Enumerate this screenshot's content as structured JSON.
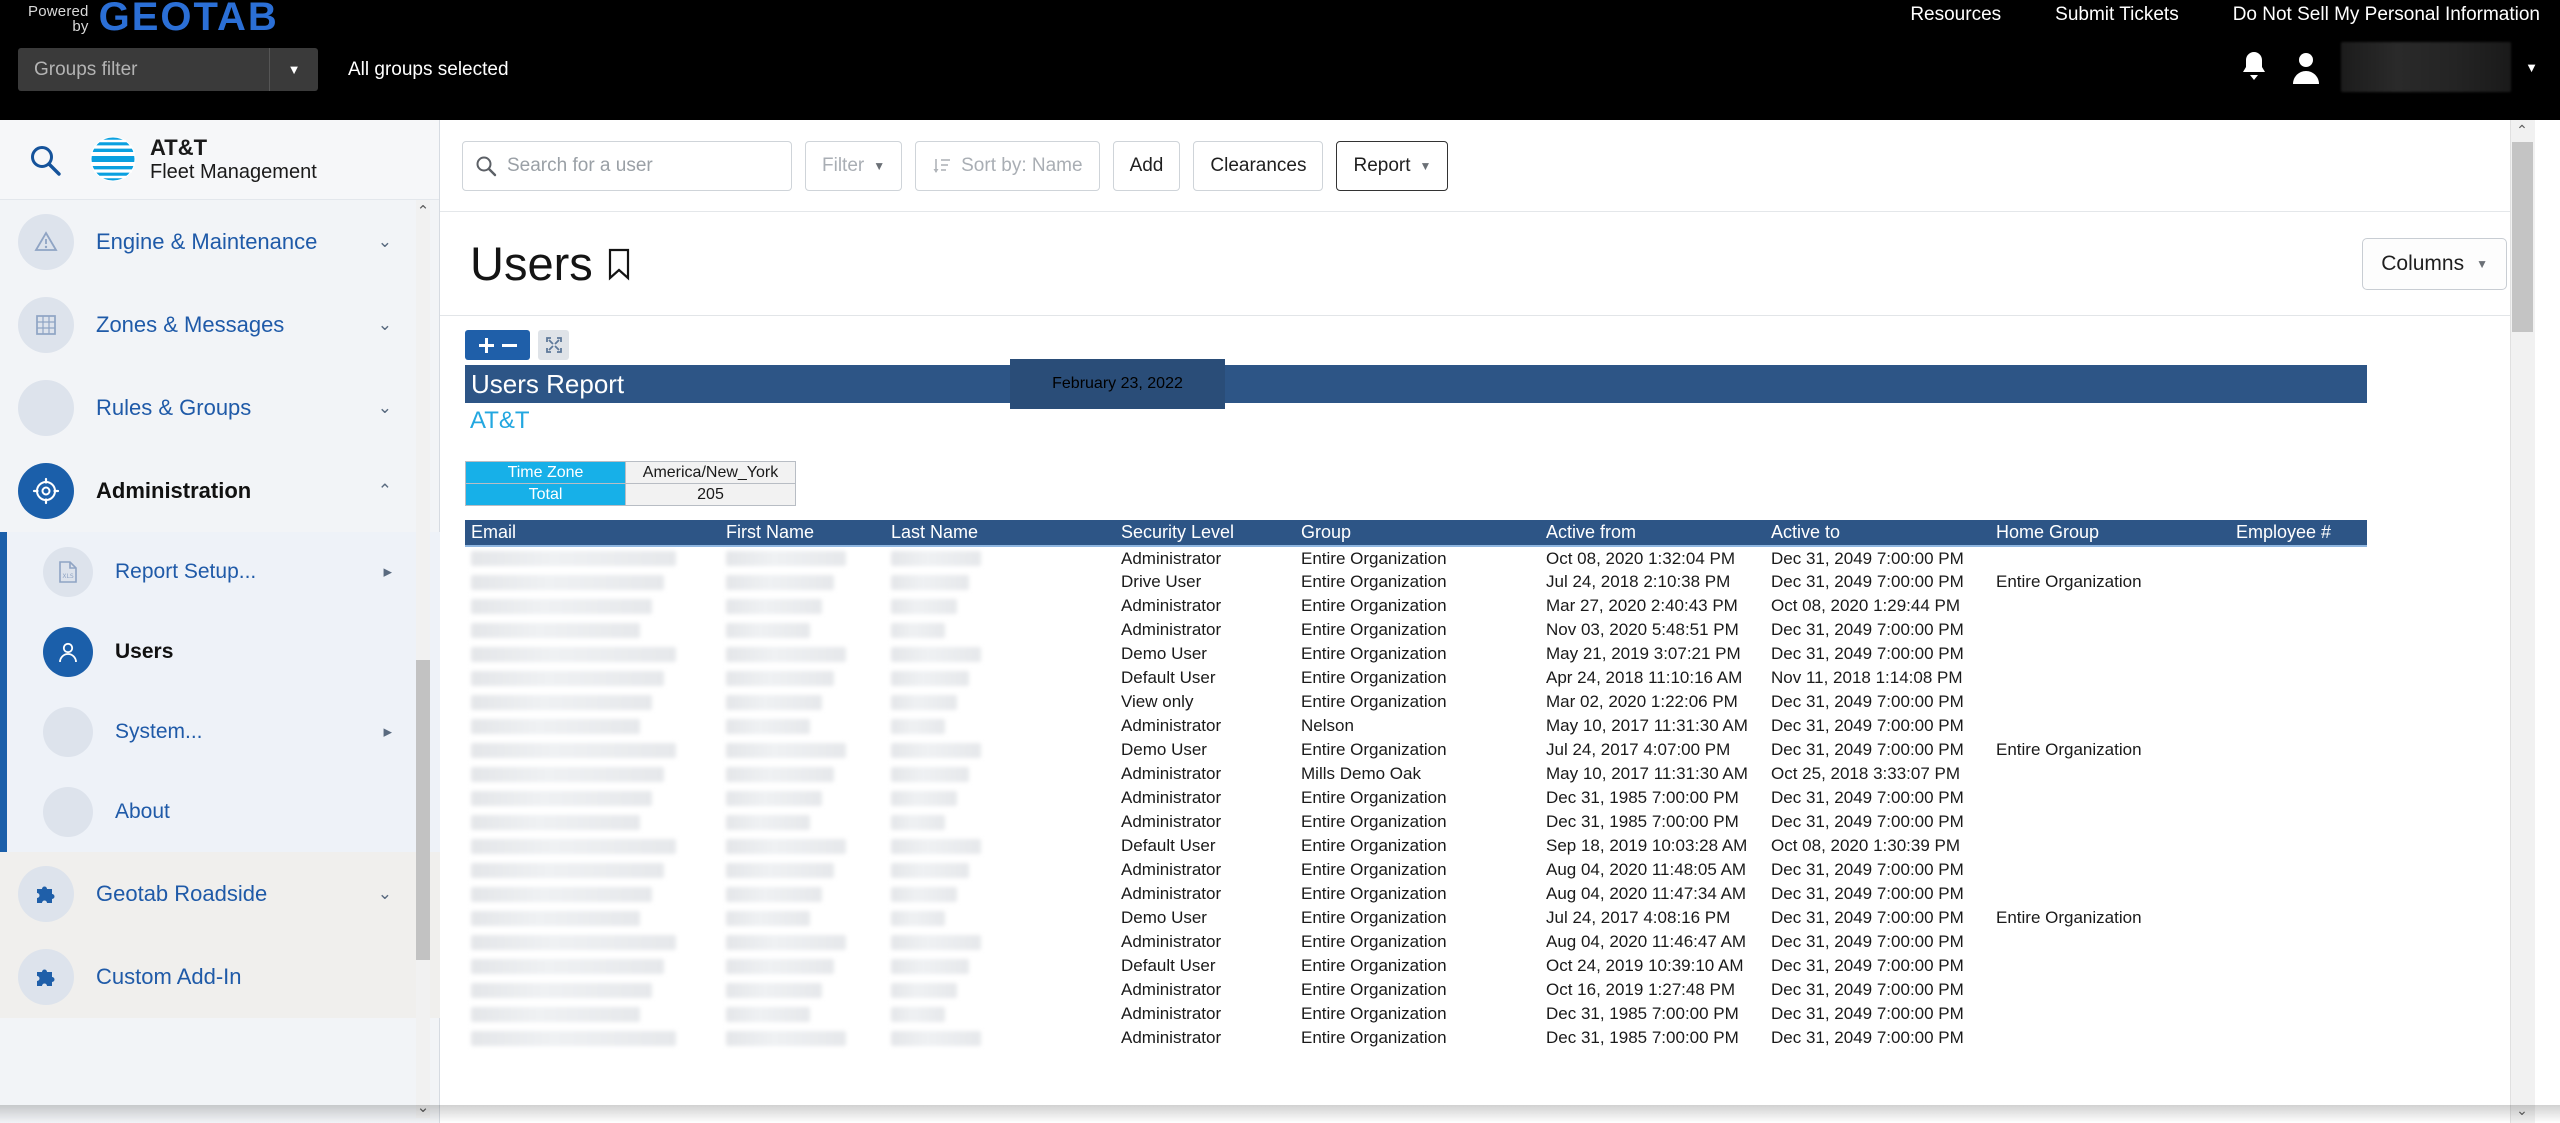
{
  "topbar": {
    "powered_line1": "Powered",
    "powered_line2": "by",
    "logo_text": "GEOTAB",
    "links": [
      {
        "label": "Resources"
      },
      {
        "label": "Submit Tickets"
      },
      {
        "label": "Do Not Sell My Personal Information"
      }
    ],
    "groups_filter_placeholder": "Groups filter",
    "groups_selected_text": "All groups selected",
    "bell_icon": "bell-icon",
    "user_icon": "user-avatar-icon",
    "user_name_redacted": ""
  },
  "sidebar": {
    "search_icon": "search-icon",
    "brand_line1": "AT&T",
    "brand_line2": "Fleet Management",
    "items": [
      {
        "label": "Engine & Maintenance",
        "icon": "engine-warning-icon",
        "expand": "chevron-down-icon",
        "active": false
      },
      {
        "label": "Zones & Messages",
        "icon": "zones-icon",
        "expand": "chevron-down-icon",
        "active": false
      },
      {
        "label": "Rules & Groups",
        "icon": "rules-icon",
        "expand": "chevron-down-icon",
        "active": false
      },
      {
        "label": "Administration",
        "icon": "gear-icon",
        "expand": "chevron-up-icon",
        "active": true
      }
    ],
    "sub_items": [
      {
        "label": "Report Setup...",
        "icon": "xls-file-icon",
        "expand": "chevron-right-icon",
        "active": false
      },
      {
        "label": "Users",
        "icon": "user-icon",
        "expand": "",
        "active": true
      },
      {
        "label": "System...",
        "icon": "",
        "expand": "chevron-right-icon",
        "active": false
      },
      {
        "label": "About",
        "icon": "",
        "expand": "",
        "active": false
      }
    ],
    "addins": [
      {
        "label": "Geotab Roadside",
        "icon": "puzzle-icon",
        "expand": "chevron-down-icon"
      },
      {
        "label": "Custom Add-In",
        "icon": "puzzle-icon",
        "expand": ""
      }
    ]
  },
  "toolbar": {
    "search_placeholder": "Search for a user",
    "search_value": "",
    "search_icon": "search-icon",
    "filter_label": "Filter",
    "sort_label": "Sort by:  Name",
    "sort_icon": "sort-icon",
    "add_label": "Add",
    "clearances_label": "Clearances",
    "report_label": "Report"
  },
  "page": {
    "title": "Users",
    "bookmark_icon": "bookmark-icon",
    "columns_label": "Columns"
  },
  "report": {
    "zoom_in_icon": "plus-icon",
    "zoom_out_icon": "minus-icon",
    "fit_icon": "fit-to-screen-icon",
    "banner_title": "Users Report",
    "banner_date": "February 23, 2022",
    "org_name": "AT&T",
    "summary": [
      {
        "label": "Time Zone",
        "value": "America/New_York"
      },
      {
        "label": "Total",
        "value": "205"
      }
    ],
    "columns": [
      "Email",
      "First Name",
      "Last Name",
      "Security Level",
      "Group",
      "Active from",
      "Active to",
      "Home Group",
      "Employee #"
    ],
    "rows": [
      {
        "email": "",
        "first_name": "",
        "last_name": "",
        "security_level": "Administrator",
        "group": "Entire Organization",
        "active_from": "Oct 08, 2020 1:32:04 PM",
        "active_to": "Dec 31, 2049 7:00:00 PM",
        "home_group": "",
        "employee_num": ""
      },
      {
        "email": "",
        "first_name": "",
        "last_name": "",
        "security_level": "Drive User",
        "group": "Entire Organization",
        "active_from": "Jul 24, 2018 2:10:38 PM",
        "active_to": "Dec 31, 2049 7:00:00 PM",
        "home_group": "Entire Organization",
        "employee_num": ""
      },
      {
        "email": "",
        "first_name": "",
        "last_name": "",
        "security_level": "Administrator",
        "group": "Entire Organization",
        "active_from": "Mar 27, 2020 2:40:43 PM",
        "active_to": "Oct 08, 2020 1:29:44 PM",
        "home_group": "",
        "employee_num": ""
      },
      {
        "email": "",
        "first_name": "",
        "last_name": "",
        "security_level": "Administrator",
        "group": "Entire Organization",
        "active_from": "Nov 03, 2020 5:48:51 PM",
        "active_to": "Dec 31, 2049 7:00:00 PM",
        "home_group": "",
        "employee_num": ""
      },
      {
        "email": "",
        "first_name": "",
        "last_name": "",
        "security_level": "Demo User",
        "group": "Entire Organization",
        "active_from": "May 21, 2019 3:07:21 PM",
        "active_to": "Dec 31, 2049 7:00:00 PM",
        "home_group": "",
        "employee_num": ""
      },
      {
        "email": "",
        "first_name": "",
        "last_name": "",
        "security_level": "Default User",
        "group": "Entire Organization",
        "active_from": "Apr 24, 2018 11:10:16 AM",
        "active_to": "Nov 11, 2018 1:14:08 PM",
        "home_group": "",
        "employee_num": ""
      },
      {
        "email": "",
        "first_name": "",
        "last_name": "",
        "security_level": "View only",
        "group": "Entire Organization",
        "active_from": "Mar 02, 2020 1:22:06 PM",
        "active_to": "Dec 31, 2049 7:00:00 PM",
        "home_group": "",
        "employee_num": ""
      },
      {
        "email": "",
        "first_name": "",
        "last_name": "",
        "security_level": "Administrator",
        "group": "Nelson",
        "active_from": "May 10, 2017 11:31:30 AM",
        "active_to": "Dec 31, 2049 7:00:00 PM",
        "home_group": "",
        "employee_num": ""
      },
      {
        "email": "",
        "first_name": "",
        "last_name": "",
        "security_level": "Demo User",
        "group": "Entire Organization",
        "active_from": "Jul 24, 2017 4:07:00 PM",
        "active_to": "Dec 31, 2049 7:00:00 PM",
        "home_group": "Entire Organization",
        "employee_num": ""
      },
      {
        "email": "",
        "first_name": "",
        "last_name": "",
        "security_level": "Administrator",
        "group": "Mills Demo Oak",
        "active_from": "May 10, 2017 11:31:30 AM",
        "active_to": "Oct 25, 2018 3:33:07 PM",
        "home_group": "",
        "employee_num": ""
      },
      {
        "email": "",
        "first_name": "",
        "last_name": "",
        "security_level": "Administrator",
        "group": "Entire Organization",
        "active_from": "Dec 31, 1985 7:00:00 PM",
        "active_to": "Dec 31, 2049 7:00:00 PM",
        "home_group": "",
        "employee_num": ""
      },
      {
        "email": "",
        "first_name": "",
        "last_name": "",
        "security_level": "Administrator",
        "group": "Entire Organization",
        "active_from": "Dec 31, 1985 7:00:00 PM",
        "active_to": "Dec 31, 2049 7:00:00 PM",
        "home_group": "",
        "employee_num": ""
      },
      {
        "email": "",
        "first_name": "",
        "last_name": "",
        "security_level": "Default User",
        "group": "Entire Organization",
        "active_from": "Sep 18, 2019 10:03:28 AM",
        "active_to": "Oct 08, 2020 1:30:39 PM",
        "home_group": "",
        "employee_num": ""
      },
      {
        "email": "",
        "first_name": "",
        "last_name": "",
        "security_level": "Administrator",
        "group": "Entire Organization",
        "active_from": "Aug 04, 2020 11:48:05 AM",
        "active_to": "Dec 31, 2049 7:00:00 PM",
        "home_group": "",
        "employee_num": ""
      },
      {
        "email": "",
        "first_name": "",
        "last_name": "",
        "security_level": "Administrator",
        "group": "Entire Organization",
        "active_from": "Aug 04, 2020 11:47:34 AM",
        "active_to": "Dec 31, 2049 7:00:00 PM",
        "home_group": "",
        "employee_num": ""
      },
      {
        "email": "",
        "first_name": "",
        "last_name": "",
        "security_level": "Demo User",
        "group": "Entire Organization",
        "active_from": "Jul 24, 2017 4:08:16 PM",
        "active_to": "Dec 31, 2049 7:00:00 PM",
        "home_group": "Entire Organization",
        "employee_num": ""
      },
      {
        "email": "",
        "first_name": "",
        "last_name": "",
        "security_level": "Administrator",
        "group": "Entire Organization",
        "active_from": "Aug 04, 2020 11:46:47 AM",
        "active_to": "Dec 31, 2049 7:00:00 PM",
        "home_group": "",
        "employee_num": ""
      },
      {
        "email": "",
        "first_name": "",
        "last_name": "",
        "security_level": "Default User",
        "group": "Entire Organization",
        "active_from": "Oct 24, 2019 10:39:10 AM",
        "active_to": "Dec 31, 2049 7:00:00 PM",
        "home_group": "",
        "employee_num": ""
      },
      {
        "email": "",
        "first_name": "",
        "last_name": "",
        "security_level": "Administrator",
        "group": "Entire Organization",
        "active_from": "Oct 16, 2019 1:27:48 PM",
        "active_to": "Dec 31, 2049 7:00:00 PM",
        "home_group": "",
        "employee_num": ""
      },
      {
        "email": "",
        "first_name": "",
        "last_name": "",
        "security_level": "Administrator",
        "group": "Entire Organization",
        "active_from": "Dec 31, 1985 7:00:00 PM",
        "active_to": "Dec 31, 2049 7:00:00 PM",
        "home_group": "",
        "employee_num": ""
      },
      {
        "email": "",
        "first_name": "",
        "last_name": "",
        "security_level": "Administrator",
        "group": "Entire Organization",
        "active_from": "Dec 31, 1985 7:00:00 PM",
        "active_to": "Dec 31, 2049 7:00:00 PM",
        "home_group": "",
        "employee_num": ""
      }
    ]
  },
  "colors": {
    "brand_blue": "#1f5fa9",
    "report_header": "#2d5586",
    "summary_label": "#17b0e8",
    "accent_cyan": "#23a7e0",
    "topbar_bg": "#000000"
  }
}
